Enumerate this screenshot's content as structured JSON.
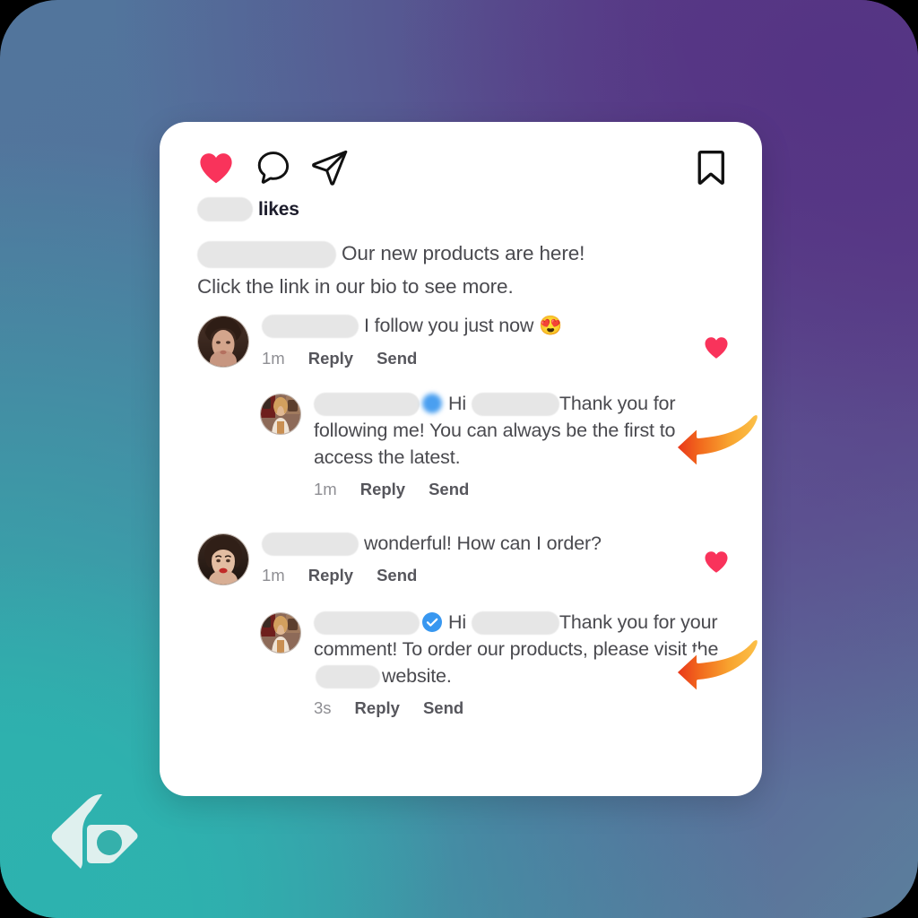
{
  "background": {
    "top_left_color": "#52759c",
    "top_right_color": "#543384",
    "bottom_left_color": "#2db2af",
    "bottom_right_color": "#52759c"
  },
  "card": {
    "background_color": "#ffffff",
    "action_bar": {
      "like_icon": "heart-filled-icon",
      "like_icon_color": "#f9335b",
      "comment_icon": "comment-bubble-icon",
      "share_icon": "paper-plane-icon",
      "save_icon": "bookmark-icon"
    },
    "likes": {
      "count_redacted": true,
      "label": "likes"
    },
    "caption": {
      "author_redacted": true,
      "line1": "Our new products are here!",
      "line2": "Click the link in our bio to see more."
    },
    "comments": [
      {
        "type": "comment",
        "avatar": "woman-portrait-avatar",
        "username_redacted": true,
        "text": "I follow you just now",
        "emoji": "😍",
        "time": "1m",
        "reply_label": "Reply",
        "send_label": "Send",
        "liked": true,
        "like_icon": "heart-filled-icon"
      },
      {
        "type": "reply",
        "avatar": "influencer-avatar",
        "username_redacted": true,
        "badge": "blurred-verified-badge",
        "greeting": "Hi",
        "mention_redacted": true,
        "text": "Thank you for following me! You can always be the first to access the latest.",
        "time": "1m",
        "reply_label": "Reply",
        "send_label": "Send",
        "liked": false,
        "annotation": "orange-curved-arrow-left"
      },
      {
        "type": "comment",
        "avatar": "woman-red-lips-avatar",
        "username_redacted": true,
        "text": "wonderful! How can I order?",
        "time": "1m",
        "reply_label": "Reply",
        "send_label": "Send",
        "liked": true,
        "like_icon": "heart-filled-icon"
      },
      {
        "type": "reply",
        "avatar": "influencer-avatar",
        "username_redacted": true,
        "badge": "verified-check-badge",
        "greeting": "Hi",
        "mention_redacted": true,
        "text_part1": "Thank you for your comment! To order our products, please visit the",
        "text_part2": "website.",
        "site_redacted": true,
        "time": "3s",
        "reply_label": "Reply",
        "send_label": "Send",
        "liked": false,
        "annotation": "orange-curved-arrow-left"
      }
    ]
  },
  "branding": {
    "logo_name": "leaf-p-logo",
    "logo_color": "#dff0ee"
  },
  "colors": {
    "heart_red": "#f9335b",
    "verified_blue": "#3897f0",
    "arrow_orange": "#f7a832",
    "arrow_red": "#e8321a",
    "text_gray": "#4a4a4f",
    "meta_gray": "#8e8e93"
  }
}
